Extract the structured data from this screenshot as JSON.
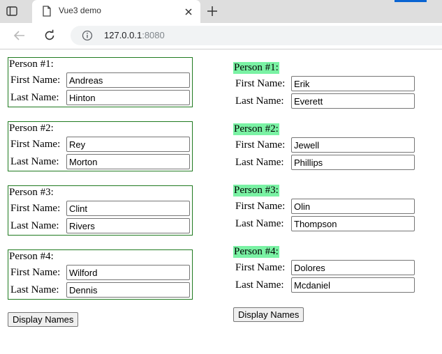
{
  "browser": {
    "tab_title": "Vue3 demo",
    "url_host": "127.0.0.1",
    "url_port": ":8080",
    "accent_color": "#0a64d2"
  },
  "left": {
    "people": [
      {
        "title": "Person #1:",
        "first_label": "First Name:",
        "first": "Andreas",
        "last_label": "Last Name:",
        "last": "Hinton"
      },
      {
        "title": "Person #2:",
        "first_label": "First Name:",
        "first": "Rey",
        "last_label": "Last Name:",
        "last": "Morton"
      },
      {
        "title": "Person #3:",
        "first_label": "First Name:",
        "first": "Clint",
        "last_label": "Last Name:",
        "last": "Rivers"
      },
      {
        "title": "Person #4:",
        "first_label": "First Name:",
        "first": "Wilford",
        "last_label": "Last Name:",
        "last": "Dennis"
      }
    ],
    "button_label": "Display Names",
    "border_color": "#1f7a1f"
  },
  "right": {
    "people": [
      {
        "title": "Person #1:",
        "first_label": "First Name:",
        "first": "Erik",
        "last_label": "Last Name:",
        "last": "Everett"
      },
      {
        "title": "Person #2:",
        "first_label": "First Name:",
        "first": "Jewell",
        "last_label": "Last Name:",
        "last": "Phillips"
      },
      {
        "title": "Person #3:",
        "first_label": "First Name:",
        "first": "Olin",
        "last_label": "Last Name:",
        "last": "Thompson"
      },
      {
        "title": "Person #4:",
        "first_label": "First Name:",
        "first": "Dolores",
        "last_label": "Last Name:",
        "last": "Mcdaniel"
      }
    ],
    "button_label": "Display Names",
    "highlight_color": "#7af2a4"
  }
}
